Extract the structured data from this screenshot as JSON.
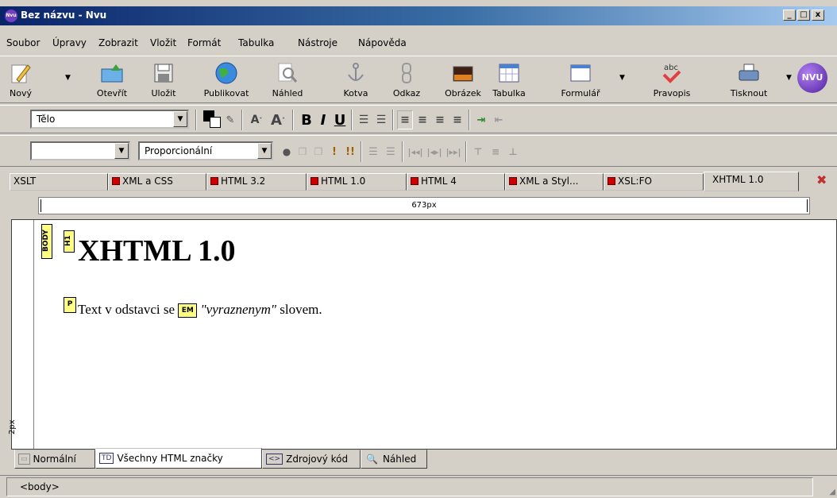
{
  "window": {
    "title": "Bez názvu - Nvu",
    "app_icon": "nvu-logo-icon"
  },
  "menu": [
    "Soubor",
    "Úpravy",
    "Zobrazit",
    "Vložit",
    "Formát",
    "Tabulka",
    "Nástroje",
    "Nápověda"
  ],
  "toolbar": {
    "new": "Nový",
    "open": "Otevřít",
    "save": "Uložit",
    "publish": "Publikovat",
    "preview": "Náhled",
    "anchor": "Kotva",
    "link": "Odkaz",
    "image": "Obrázek",
    "table": "Tabulka",
    "form": "Formulář",
    "spell": "Pravopis",
    "print": "Tisknout",
    "logo": "NVU"
  },
  "format_bar": {
    "paragraph_style": "Tělo",
    "font": "Proporcionální",
    "text_color": "#000000",
    "bg_color": "#ffffff"
  },
  "doc_tabs": [
    "XSLT",
    "XML a CSS",
    "HTML 3.2",
    "HTML 1.0",
    "HTML 4",
    "XML a Styl...",
    "XSL:FO",
    "XHTML 1.0"
  ],
  "active_doc_tab": "XHTML 1.0",
  "ruler": {
    "width_label": "673px",
    "height_label": "2px"
  },
  "content": {
    "tags": {
      "body": "BODY",
      "h1": "H1",
      "p": "P",
      "em": "EM"
    },
    "heading": "XHTML 1.0",
    "para_before": "Text v odstavci se ",
    "para_em": "\"vyraznenym\"",
    "para_after": " slovem."
  },
  "mode_tabs": {
    "normal": "Normální",
    "all_tags": "Všechny HTML značky",
    "source": "Zdrojový kód",
    "preview": "Náhled",
    "all_tags_icon": "TD"
  },
  "status": "<body>"
}
